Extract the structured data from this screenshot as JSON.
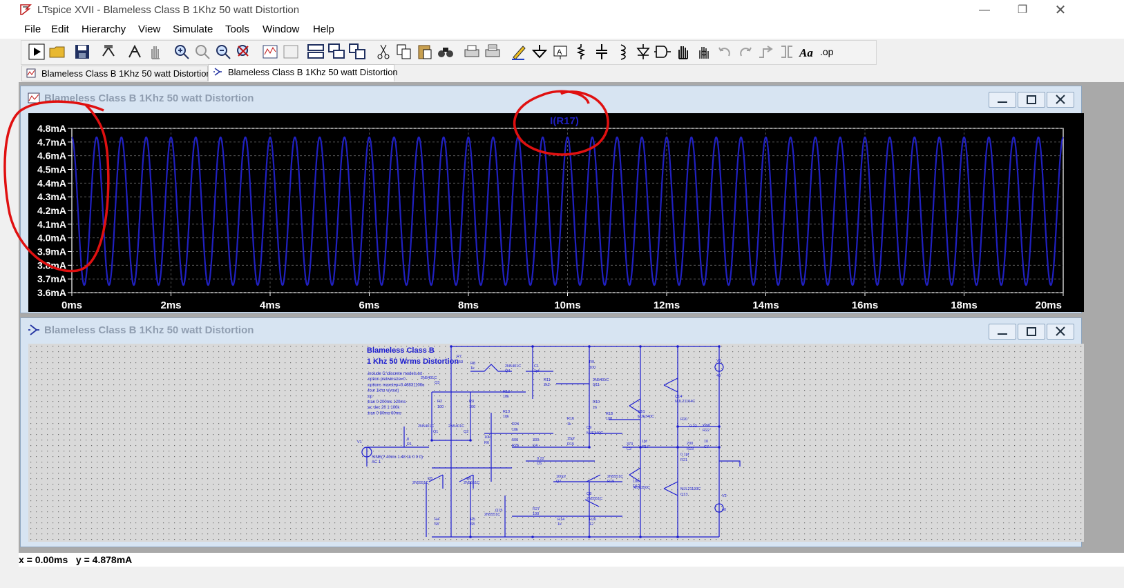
{
  "window": {
    "title": "LTspice XVII - Blameless Class B 1Khz 50 watt Distortion"
  },
  "menu": [
    "File",
    "Edit",
    "Hierarchy",
    "View",
    "Simulate",
    "Tools",
    "Window",
    "Help"
  ],
  "tabs": [
    {
      "label": "Blameless Class B 1Khz 50 watt Distortion",
      "kind": "waveform"
    },
    {
      "label": "Blameless Class B 1Khz 50 watt Distortion",
      "kind": "schematic"
    }
  ],
  "plot_window": {
    "title": "Blameless Class B 1Khz 50 watt Distortion",
    "trace_label": "I(R17)",
    "y_ticks": [
      "4.8mA",
      "4.7mA",
      "4.6mA",
      "4.5mA",
      "4.4mA",
      "4.3mA",
      "4.2mA",
      "4.1mA",
      "4.0mA",
      "3.9mA",
      "3.8mA",
      "3.7mA",
      "3.6mA"
    ],
    "x_ticks": [
      "0ms",
      "2ms",
      "4ms",
      "6ms",
      "8ms",
      "10ms",
      "12ms",
      "14ms",
      "16ms",
      "18ms",
      "20ms"
    ]
  },
  "schematic_window": {
    "title": "Blameless Class B 1Khz 50 watt Distortion",
    "heading1": "Blameless Class B",
    "heading2": "1 Khz 50 Wrms Distortion",
    "directives": [
      ".include C:\\discrete models.txt",
      ".option plotwinsize=0",
      ".options maxstep=0.48831106u",
      ".four 1khz v(vout)",
      ";op",
      ";tran 0 200ms 120ms",
      ";ac dec 20 1 100k",
      ".tran 0 80ms 60ms"
    ],
    "source_label": "SINE(7.40ms 1.48 1k 0 0 0)",
    "source_ac": "AC 1",
    "components": [
      "R7",
      "150",
      "R8",
      "1k",
      "2N5401C",
      "Q4",
      "C1",
      "1pf",
      "R9",
      "100",
      "2N5401C",
      "Q3",
      "R11",
      "2k2",
      "2N5401C",
      "Q11",
      "R12",
      "10k",
      "R13",
      "10k",
      "R2",
      "100",
      "R3",
      "100",
      "R10",
      "16",
      "R18",
      "100",
      "Q10",
      "MJE340C",
      "Q14",
      "MJL21194C",
      "2N5401C",
      "2N5401C",
      "Q1",
      "Q2",
      "R24",
      "10k",
      "R16",
      "1k",
      "Q9",
      "MJE340C",
      "R20",
      "0.22",
      "vout",
      "R22",
      "8",
      "R1",
      "10k",
      "R6",
      "500",
      "R25",
      "330",
      "C4",
      "15pf",
      "R15",
      "373",
      "C2",
      "1pf",
      "R17",
      "200",
      "R23",
      "10",
      "C7",
      "0.1pf",
      "R21",
      "0.22",
      "C6",
      "100pf",
      "Q7",
      "2N5551C",
      "R19",
      "100",
      "Q12",
      "MJE350C",
      "MJL21193C",
      "Q13",
      "Q5",
      "2N5551C",
      "Q6",
      "2N5551C",
      "Q8",
      "2N5551C",
      "Q15",
      "2N5551C",
      "R27",
      "100",
      "R4",
      "68",
      "R5",
      "68",
      "R14",
      "1k",
      "R26",
      "12",
      "V1",
      "V2",
      "V3",
      "40",
      "40"
    ]
  },
  "status": {
    "x_label": "x =",
    "x_value": "0.00ms",
    "y_label": "y =",
    "y_value": "4.878mA"
  },
  "chart_data": {
    "type": "line",
    "title": "",
    "trace": "I(R17)",
    "xlabel": "",
    "ylabel": "",
    "xlim": [
      0,
      20
    ],
    "ylim": [
      3.6,
      4.8
    ],
    "x_unit": "ms",
    "y_unit": "mA",
    "series": [
      {
        "name": "I(R17)",
        "waveform": "sine",
        "frequency_khz": 2,
        "min": 3.655,
        "max": 4.735,
        "start_value": 4.735,
        "color": "#2020c0"
      }
    ],
    "grid": true
  },
  "colors": {
    "plot_bg": "#000000",
    "trace": "#2020c0",
    "grid": "#6a6a6a",
    "axis_text": "#ffffff",
    "annotation": "#e01010",
    "schematic_wire": "#1a1ad0",
    "schematic_text": "#1a1ad0"
  }
}
